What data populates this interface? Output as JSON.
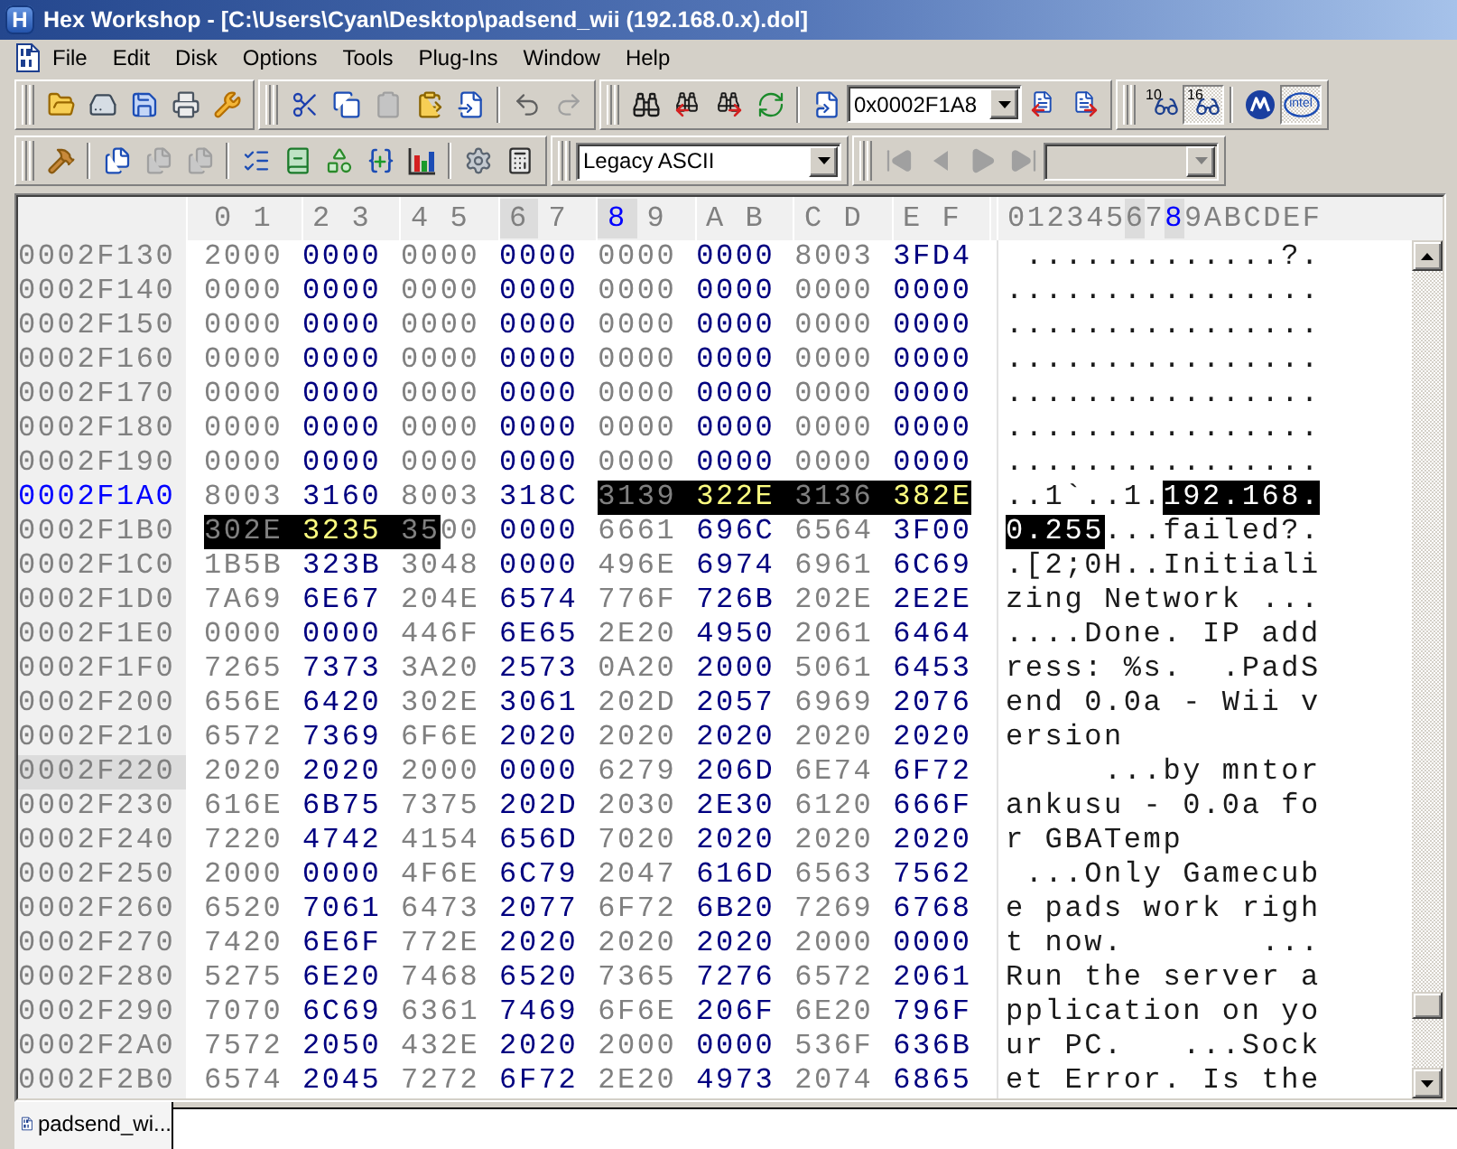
{
  "window": {
    "app_icon": "H",
    "title": "Hex Workshop - [C:\\Users\\Cyan\\Desktop\\padsend_wii (192.168.0.x).dol]"
  },
  "menu": [
    "File",
    "Edit",
    "Disk",
    "Options",
    "Tools",
    "Plug-Ins",
    "Window",
    "Help"
  ],
  "toolbars": [
    {
      "groups": [
        {
          "items": [
            {
              "kind": "button",
              "disabled": false,
              "pressed": false
            },
            {
              "kind": "button",
              "disabled": false,
              "pressed": false
            },
            {
              "kind": "button",
              "disabled": false,
              "pressed": false
            },
            {
              "kind": "button",
              "disabled": false,
              "pressed": false
            },
            {
              "kind": "button",
              "disabled": false,
              "pressed": false
            }
          ]
        },
        {
          "items": [
            {
              "kind": "button",
              "disabled": false,
              "pressed": false
            },
            {
              "kind": "button",
              "disabled": false,
              "pressed": false
            },
            {
              "kind": "button",
              "disabled": true,
              "pressed": false
            },
            {
              "kind": "button",
              "disabled": false,
              "pressed": false
            },
            {
              "kind": "button",
              "disabled": false,
              "pressed": false
            },
            {
              "kind": "separator"
            },
            {
              "kind": "button",
              "disabled": false,
              "pressed": false
            },
            {
              "kind": "button",
              "disabled": true,
              "pressed": false
            }
          ]
        },
        {
          "items": [
            {
              "kind": "button",
              "disabled": false,
              "pressed": false
            },
            {
              "kind": "button",
              "disabled": false,
              "pressed": false
            },
            {
              "kind": "button",
              "disabled": false,
              "pressed": false
            },
            {
              "kind": "button",
              "disabled": false,
              "pressed": false
            },
            {
              "kind": "separator"
            },
            {
              "kind": "button",
              "disabled": false,
              "pressed": false
            },
            {
              "kind": "combo",
              "value": "0x0002F1A8",
              "disabled": false
            },
            {
              "kind": "button",
              "disabled": false,
              "pressed": false
            },
            {
              "kind": "button",
              "disabled": false,
              "pressed": false
            }
          ]
        },
        {
          "items": [
            {
              "kind": "button",
              "label": "10",
              "disabled": false,
              "pressed": false
            },
            {
              "kind": "button",
              "label": "16",
              "disabled": false,
              "pressed": true
            },
            {
              "kind": "separator"
            },
            {
              "kind": "button",
              "disabled": false,
              "pressed": false
            },
            {
              "kind": "button",
              "label": "intel",
              "disabled": false,
              "pressed": true
            }
          ]
        }
      ]
    },
    {
      "groups": [
        {
          "items": [
            {
              "kind": "button",
              "disabled": false,
              "pressed": false
            },
            {
              "kind": "separator"
            },
            {
              "kind": "button",
              "disabled": false,
              "pressed": false
            },
            {
              "kind": "button",
              "disabled": true,
              "pressed": false
            },
            {
              "kind": "button",
              "disabled": true,
              "pressed": false
            },
            {
              "kind": "separator"
            },
            {
              "kind": "button",
              "disabled": false,
              "pressed": false
            },
            {
              "kind": "button",
              "disabled": false,
              "pressed": false
            },
            {
              "kind": "button",
              "disabled": false,
              "pressed": false
            },
            {
              "kind": "button",
              "disabled": false,
              "pressed": false
            },
            {
              "kind": "button",
              "disabled": false,
              "pressed": false
            },
            {
              "kind": "separator"
            },
            {
              "kind": "button",
              "disabled": false,
              "pressed": false
            },
            {
              "kind": "button",
              "disabled": false,
              "pressed": false
            }
          ]
        },
        {
          "items": [
            {
              "kind": "combo",
              "value": "Legacy ASCII",
              "disabled": false
            }
          ]
        },
        {
          "items": [
            {
              "kind": "button",
              "disabled": true,
              "pressed": false
            },
            {
              "kind": "button",
              "disabled": true,
              "pressed": false
            },
            {
              "kind": "button",
              "disabled": true,
              "pressed": false
            },
            {
              "kind": "button",
              "disabled": true,
              "pressed": false
            },
            {
              "kind": "combo",
              "disabled": true
            }
          ]
        }
      ]
    }
  ],
  "editor": {
    "hex_header": [
      {
        "label": "0",
        "hovered": false,
        "cursor": false
      },
      {
        "label": "1",
        "hovered": false,
        "cursor": false
      },
      {
        "label": "2",
        "hovered": false,
        "cursor": false
      },
      {
        "label": "3",
        "hovered": false,
        "cursor": false
      },
      {
        "label": "4",
        "hovered": false,
        "cursor": false
      },
      {
        "label": "5",
        "hovered": false,
        "cursor": false
      },
      {
        "label": "6",
        "hovered": true,
        "cursor": false
      },
      {
        "label": "7",
        "hovered": false,
        "cursor": false
      },
      {
        "label": "8",
        "hovered": false,
        "cursor": true
      },
      {
        "label": "9",
        "hovered": false,
        "cursor": false
      },
      {
        "label": "A",
        "hovered": false,
        "cursor": false
      },
      {
        "label": "B",
        "hovered": false,
        "cursor": false
      },
      {
        "label": "C",
        "hovered": false,
        "cursor": false
      },
      {
        "label": "D",
        "hovered": false,
        "cursor": false
      },
      {
        "label": "E",
        "hovered": false,
        "cursor": false
      },
      {
        "label": "F",
        "hovered": false,
        "cursor": false
      }
    ],
    "ascii_header": [
      {
        "label": "0",
        "hovered": false,
        "cursor": false
      },
      {
        "label": "1",
        "hovered": false,
        "cursor": false
      },
      {
        "label": "2",
        "hovered": false,
        "cursor": false
      },
      {
        "label": "3",
        "hovered": false,
        "cursor": false
      },
      {
        "label": "4",
        "hovered": false,
        "cursor": false
      },
      {
        "label": "5",
        "hovered": false,
        "cursor": false
      },
      {
        "label": "6",
        "hovered": true,
        "cursor": false
      },
      {
        "label": "7",
        "hovered": false,
        "cursor": false
      },
      {
        "label": "8",
        "hovered": false,
        "cursor": true
      },
      {
        "label": "9",
        "hovered": false,
        "cursor": false
      },
      {
        "label": "A",
        "hovered": false,
        "cursor": false
      },
      {
        "label": "B",
        "hovered": false,
        "cursor": false
      },
      {
        "label": "C",
        "hovered": false,
        "cursor": false
      },
      {
        "label": "D",
        "hovered": false,
        "cursor": false
      },
      {
        "label": "E",
        "hovered": false,
        "cursor": false
      },
      {
        "label": "F",
        "hovered": false,
        "cursor": false
      }
    ],
    "rows": [
      {
        "address": "0002F130",
        "cursor": false,
        "hovered": false,
        "hex": [
          {
            "text": "2000 0000 0000 0000 0000 0000 8003 3FD4",
            "selected": false
          }
        ],
        "ascii": [
          {
            "text": " .............?.",
            "selected": false
          }
        ]
      },
      {
        "address": "0002F140",
        "cursor": false,
        "hovered": false,
        "hex": [
          {
            "text": "0000 0000 0000 0000 0000 0000 0000 0000",
            "selected": false
          }
        ],
        "ascii": [
          {
            "text": "................",
            "selected": false
          }
        ]
      },
      {
        "address": "0002F150",
        "cursor": false,
        "hovered": false,
        "hex": [
          {
            "text": "0000 0000 0000 0000 0000 0000 0000 0000",
            "selected": false
          }
        ],
        "ascii": [
          {
            "text": "................",
            "selected": false
          }
        ]
      },
      {
        "address": "0002F160",
        "cursor": false,
        "hovered": false,
        "hex": [
          {
            "text": "0000 0000 0000 0000 0000 0000 0000 0000",
            "selected": false
          }
        ],
        "ascii": [
          {
            "text": "................",
            "selected": false
          }
        ]
      },
      {
        "address": "0002F170",
        "cursor": false,
        "hovered": false,
        "hex": [
          {
            "text": "0000 0000 0000 0000 0000 0000 0000 0000",
            "selected": false
          }
        ],
        "ascii": [
          {
            "text": "................",
            "selected": false
          }
        ]
      },
      {
        "address": "0002F180",
        "cursor": false,
        "hovered": false,
        "hex": [
          {
            "text": "0000 0000 0000 0000 0000 0000 0000 0000",
            "selected": false
          }
        ],
        "ascii": [
          {
            "text": "................",
            "selected": false
          }
        ]
      },
      {
        "address": "0002F190",
        "cursor": false,
        "hovered": false,
        "hex": [
          {
            "text": "0000 0000 0000 0000 0000 0000 0000 0000",
            "selected": false
          }
        ],
        "ascii": [
          {
            "text": "................",
            "selected": false
          }
        ]
      },
      {
        "address": "0002F1A0",
        "cursor": true,
        "hovered": false,
        "hex": [
          {
            "text": "8003 3160 8003 318C",
            "selected": false
          },
          {
            "text": "3139 322E 3136 382E",
            "selected": true
          }
        ],
        "ascii": [
          {
            "text": "..1`..1.",
            "selected": false
          },
          {
            "text": "192.168.",
            "selected": true
          }
        ]
      },
      {
        "address": "0002F1B0",
        "cursor": false,
        "hovered": false,
        "hex": [
          {
            "text": "302E 3235 35",
            "selected": true
          },
          {
            "text": "00 0000 6661 696C 6564 3F00",
            "selected": false
          }
        ],
        "ascii": [
          {
            "text": "0.255",
            "selected": true
          },
          {
            "text": "...failed?.",
            "selected": false
          }
        ]
      },
      {
        "address": "0002F1C0",
        "cursor": false,
        "hovered": false,
        "hex": [
          {
            "text": "1B5B 323B 3048 0000 496E 6974 6961 6C69",
            "selected": false
          }
        ],
        "ascii": [
          {
            "text": ".[2;0H..Initiali",
            "selected": false
          }
        ]
      },
      {
        "address": "0002F1D0",
        "cursor": false,
        "hovered": false,
        "hex": [
          {
            "text": "7A69 6E67 204E 6574 776F 726B 202E 2E2E",
            "selected": false
          }
        ],
        "ascii": [
          {
            "text": "zing Network ...",
            "selected": false
          }
        ]
      },
      {
        "address": "0002F1E0",
        "cursor": false,
        "hovered": false,
        "hex": [
          {
            "text": "0000 0000 446F 6E65 2E20 4950 2061 6464",
            "selected": false
          }
        ],
        "ascii": [
          {
            "text": "....Done. IP add",
            "selected": false
          }
        ]
      },
      {
        "address": "0002F1F0",
        "cursor": false,
        "hovered": false,
        "hex": [
          {
            "text": "7265 7373 3A20 2573 0A20 2000 5061 6453",
            "selected": false
          }
        ],
        "ascii": [
          {
            "text": "ress: %s.  .PadS",
            "selected": false
          }
        ]
      },
      {
        "address": "0002F200",
        "cursor": false,
        "hovered": false,
        "hex": [
          {
            "text": "656E 6420 302E 3061 202D 2057 6969 2076",
            "selected": false
          }
        ],
        "ascii": [
          {
            "text": "end 0.0a - Wii v",
            "selected": false
          }
        ]
      },
      {
        "address": "0002F210",
        "cursor": false,
        "hovered": false,
        "hex": [
          {
            "text": "6572 7369 6F6E 2020 2020 2020 2020 2020",
            "selected": false
          }
        ],
        "ascii": [
          {
            "text": "ersion",
            "selected": false
          }
        ]
      },
      {
        "address": "0002F220",
        "cursor": false,
        "hovered": true,
        "hex": [
          {
            "text": "2020 2020 2000 0000 6279 206D 6E74 6F72",
            "selected": false
          }
        ],
        "ascii": [
          {
            "text": "     ...by mntor",
            "selected": false
          }
        ]
      },
      {
        "address": "0002F230",
        "cursor": false,
        "hovered": false,
        "hex": [
          {
            "text": "616E 6B75 7375 202D 2030 2E30 6120 666F",
            "selected": false
          }
        ],
        "ascii": [
          {
            "text": "ankusu - 0.0a fo",
            "selected": false
          }
        ]
      },
      {
        "address": "0002F240",
        "cursor": false,
        "hovered": false,
        "hex": [
          {
            "text": "7220 4742 4154 656D 7020 2020 2020 2020",
            "selected": false
          }
        ],
        "ascii": [
          {
            "text": "r GBATemp",
            "selected": false
          }
        ]
      },
      {
        "address": "0002F250",
        "cursor": false,
        "hovered": false,
        "hex": [
          {
            "text": "2000 0000 4F6E 6C79 2047 616D 6563 7562",
            "selected": false
          }
        ],
        "ascii": [
          {
            "text": " ...Only Gamecub",
            "selected": false
          }
        ]
      },
      {
        "address": "0002F260",
        "cursor": false,
        "hovered": false,
        "hex": [
          {
            "text": "6520 7061 6473 2077 6F72 6B20 7269 6768",
            "selected": false
          }
        ],
        "ascii": [
          {
            "text": "e pads work righ",
            "selected": false
          }
        ]
      },
      {
        "address": "0002F270",
        "cursor": false,
        "hovered": false,
        "hex": [
          {
            "text": "7420 6E6F 772E 2020 2020 2020 2000 0000",
            "selected": false
          }
        ],
        "ascii": [
          {
            "text": "t now.       ...",
            "selected": false
          }
        ]
      },
      {
        "address": "0002F280",
        "cursor": false,
        "hovered": false,
        "hex": [
          {
            "text": "5275 6E20 7468 6520 7365 7276 6572 2061",
            "selected": false
          }
        ],
        "ascii": [
          {
            "text": "Run the server a",
            "selected": false
          }
        ]
      },
      {
        "address": "0002F290",
        "cursor": false,
        "hovered": false,
        "hex": [
          {
            "text": "7070 6C69 6361 7469 6F6E 206F 6E20 796F",
            "selected": false
          }
        ],
        "ascii": [
          {
            "text": "pplication on yo",
            "selected": false
          }
        ]
      },
      {
        "address": "0002F2A0",
        "cursor": false,
        "hovered": false,
        "hex": [
          {
            "text": "7572 2050 432E 2020 2000 0000 536F 636B",
            "selected": false
          }
        ],
        "ascii": [
          {
            "text": "ur PC.   ...Sock",
            "selected": false
          }
        ]
      },
      {
        "address": "0002F2B0",
        "cursor": false,
        "hovered": false,
        "hex": [
          {
            "text": "6574 2045 7272 6F72 2E20 4973 2074 6865",
            "selected": false
          }
        ],
        "ascii": [
          {
            "text": "et Error. Is the",
            "selected": false
          }
        ]
      }
    ]
  },
  "tabs": [
    {
      "label": "padsend_wi...",
      "selected": true
    }
  ]
}
